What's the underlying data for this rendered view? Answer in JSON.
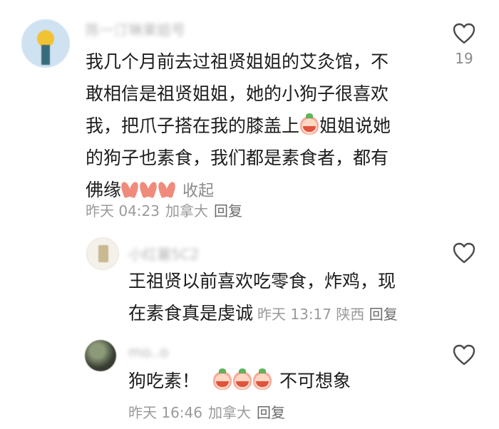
{
  "comments": [
    {
      "username": "陈一汀琳果姐号",
      "body_lines": [
        "我几个月前去过祖贤姐姐的艾灸馆，不",
        "敢相信是祖贤姐姐，她的小狗子很喜欢",
        "我，把爪子搭在我的膝盖上",
        "姐姐说她",
        "的狗子也素食，我们都是素食者，都有",
        "佛缘"
      ],
      "collapse_label": "收起",
      "time": "昨天 04:23",
      "location": "加拿大",
      "reply_label": "回复",
      "like_count": "19"
    },
    {
      "username": "小红薯5C2",
      "body_lines": [
        "王祖贤以前喜欢吃零食，炸鸡，现",
        "在素食真是虔诚"
      ],
      "time": "昨天 13:17",
      "location": "陕西",
      "reply_label": "回复"
    },
    {
      "username": "mo..o",
      "body_text": "狗吃素！",
      "body_suffix": "不可想象",
      "time": "昨天 16:46",
      "location": "加拿大",
      "reply_label": "回复"
    }
  ],
  "icons": {
    "like": "heart-outline-icon",
    "crying_emoji": "crying-face-emoji-icon",
    "praying_hands": "praying-hands-emoji-icon"
  }
}
